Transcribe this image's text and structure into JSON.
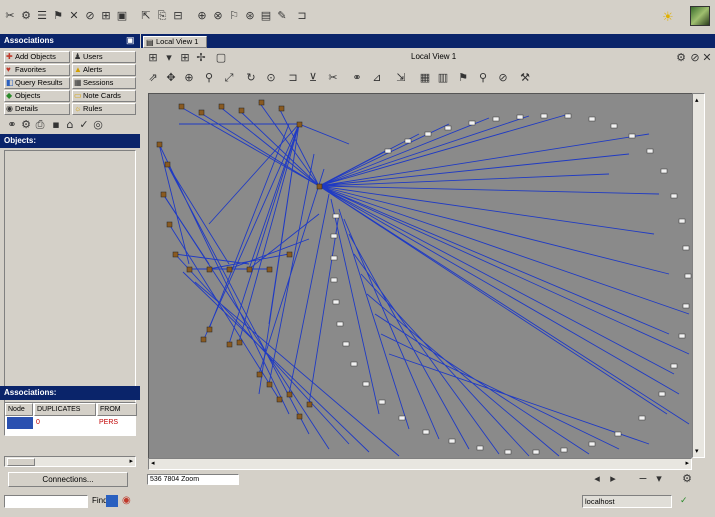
{
  "left_panel": {
    "header": "Associations",
    "nav": [
      {
        "label": "Add Objects",
        "icon": "add-icon"
      },
      {
        "label": "Users",
        "icon": "user-icon"
      },
      {
        "label": "Favorites",
        "icon": "favorites-icon"
      },
      {
        "label": "Alerts",
        "icon": "alert-icon"
      },
      {
        "label": "Query Results",
        "icon": "query-icon"
      },
      {
        "label": "Sessions",
        "icon": "sessions-icon"
      },
      {
        "label": "Objects",
        "icon": "objects-icon"
      },
      {
        "label": "Note Cards",
        "icon": "note-icon"
      },
      {
        "label": "Details",
        "icon": "details-icon"
      },
      {
        "label": "Rules",
        "icon": "rules-icon"
      }
    ],
    "objects_header": "Objects:",
    "associations_header": "Associations:",
    "grid_headers": [
      "Node",
      "DUPLICATES",
      "FROM"
    ],
    "grid_row": [
      "",
      "0",
      "PERS"
    ],
    "connections_button": "Connections..."
  },
  "main": {
    "tab": "Local View 1",
    "view_title": "Local View 1",
    "status_count": "536  7804  Zoom"
  },
  "bottom": {
    "find_label": "Find",
    "host": "localhost"
  }
}
